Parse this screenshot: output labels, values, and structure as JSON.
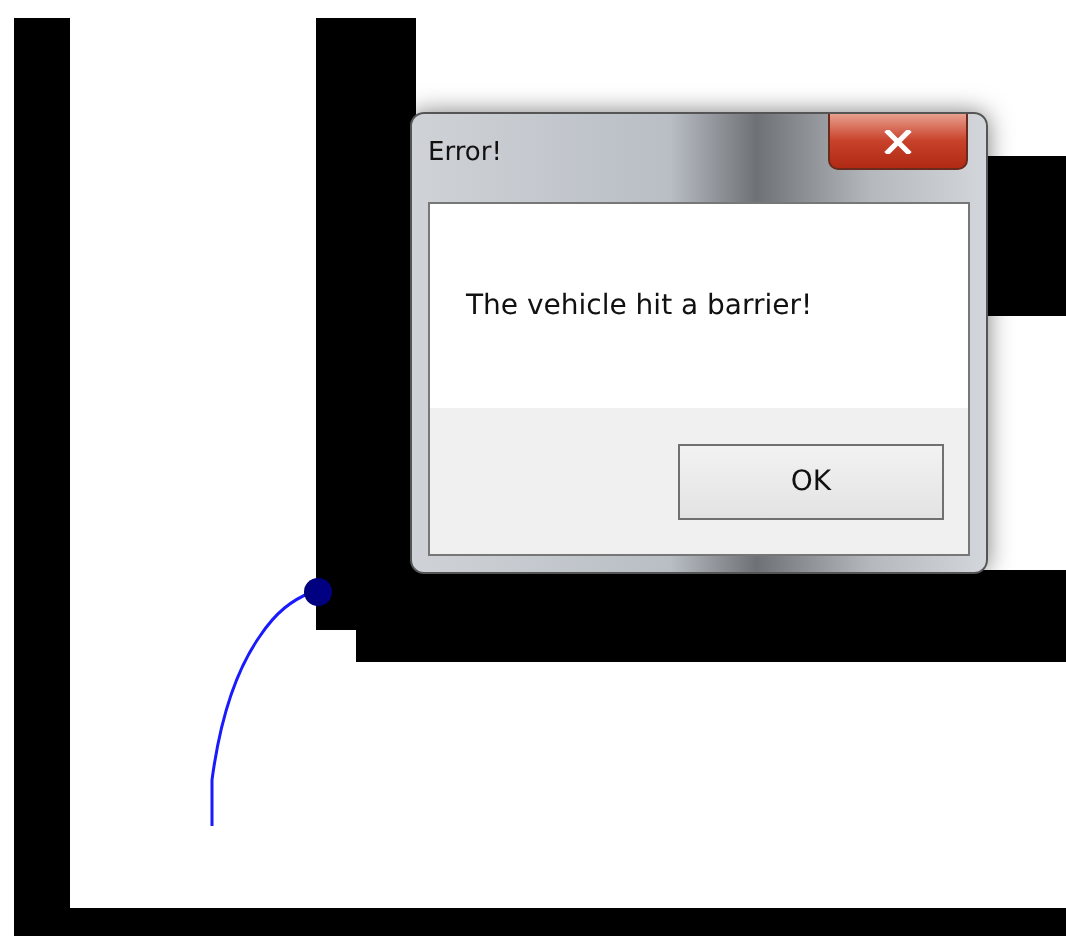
{
  "dialog": {
    "title": "Error!",
    "message": "The vehicle hit a barrier!",
    "buttons": [
      "OK"
    ]
  }
}
